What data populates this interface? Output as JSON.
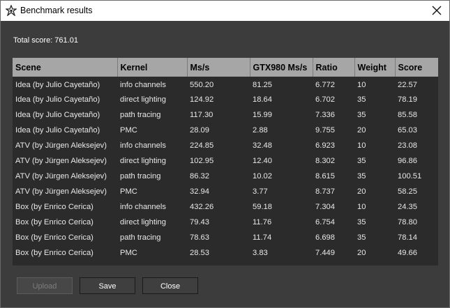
{
  "window": {
    "title": "Benchmark results"
  },
  "summary": {
    "total_label": "Total score: 761.01"
  },
  "table": {
    "headers": [
      "Scene",
      "Kernel",
      "Ms/s",
      "GTX980 Ms/s",
      "Ratio",
      "Weight",
      "Score"
    ],
    "rows": [
      [
        "Idea (by Julio Cayetaño)",
        "info channels",
        "550.20",
        "81.25",
        "6.772",
        "10",
        "22.57"
      ],
      [
        "Idea (by Julio Cayetaño)",
        "direct lighting",
        "124.92",
        "18.64",
        "6.702",
        "35",
        "78.19"
      ],
      [
        "Idea (by Julio Cayetaño)",
        "path tracing",
        "117.30",
        "15.99",
        "7.336",
        "35",
        "85.58"
      ],
      [
        "Idea (by Julio Cayetaño)",
        "PMC",
        "28.09",
        "2.88",
        "9.755",
        "20",
        "65.03"
      ],
      [
        "ATV (by Jürgen Aleksejev)",
        "info channels",
        "224.85",
        "32.48",
        "6.923",
        "10",
        "23.08"
      ],
      [
        "ATV (by Jürgen Aleksejev)",
        "direct lighting",
        "102.95",
        "12.40",
        "8.302",
        "35",
        "96.86"
      ],
      [
        "ATV (by Jürgen Aleksejev)",
        "path tracing",
        "86.32",
        "10.02",
        "8.615",
        "35",
        "100.51"
      ],
      [
        "ATV (by Jürgen Aleksejev)",
        "PMC",
        "32.94",
        "3.77",
        "8.737",
        "20",
        "58.25"
      ],
      [
        "Box (by Enrico Cerica)",
        "info channels",
        "432.26",
        "59.18",
        "7.304",
        "10",
        "24.35"
      ],
      [
        "Box (by Enrico Cerica)",
        "direct lighting",
        "79.43",
        "11.76",
        "6.754",
        "35",
        "78.80"
      ],
      [
        "Box (by Enrico Cerica)",
        "path tracing",
        "78.63",
        "11.74",
        "6.698",
        "35",
        "78.14"
      ],
      [
        "Box (by Enrico Cerica)",
        "PMC",
        "28.53",
        "3.83",
        "7.449",
        "20",
        "49.66"
      ]
    ]
  },
  "buttons": {
    "upload_label": "Upload",
    "save_label": "Save",
    "close_label": "Close"
  },
  "icons": {
    "app": "octane-logo-icon",
    "close": "close-icon"
  },
  "colors": {
    "window_bg": "#3c3c3c",
    "table_bg": "#2b2b2b",
    "header_bg": "#a6a6a6",
    "titlebar_bg": "#ffffff"
  }
}
